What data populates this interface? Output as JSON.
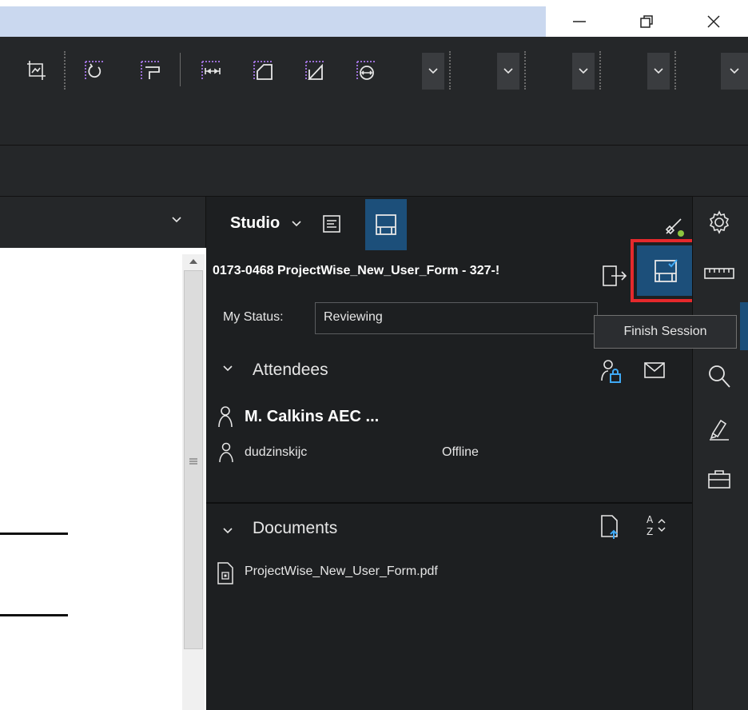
{
  "window": {
    "minimize_icon": "minimize-icon",
    "restore_icon": "restore-icon",
    "close_icon": "close-icon"
  },
  "toolbar": {
    "icons": [
      "crop-icon",
      "rotate-icon",
      "flip-icon",
      "measure-length-icon",
      "area-icon",
      "perimeter-icon",
      "circle-measure-icon"
    ],
    "dropdowns": [
      "chevron-down-icon",
      "chevron-down-icon",
      "chevron-down-icon",
      "chevron-down-icon",
      "chevron-down-icon"
    ]
  },
  "studio": {
    "label": "Studio",
    "session_title": "0173-0468 ProjectWise_New_User_Form - 327-!",
    "my_status_label": "My Status:",
    "my_status_value": "Reviewing",
    "tooltip": "Finish Session"
  },
  "attendees": {
    "heading": "Attendees",
    "items": [
      {
        "name": "M. Calkins AEC ...",
        "status": ""
      },
      {
        "name": "dudzinskijc",
        "status": "Offline"
      }
    ]
  },
  "documents": {
    "heading": "Documents",
    "files": [
      {
        "name": "ProjectWise_New_User_Form.pdf"
      }
    ]
  },
  "colors": {
    "accent_blue": "#1c4f7a",
    "highlight_red": "#e5292c",
    "panel_bg": "#1d1f21",
    "toolbar_bg": "#252729"
  }
}
